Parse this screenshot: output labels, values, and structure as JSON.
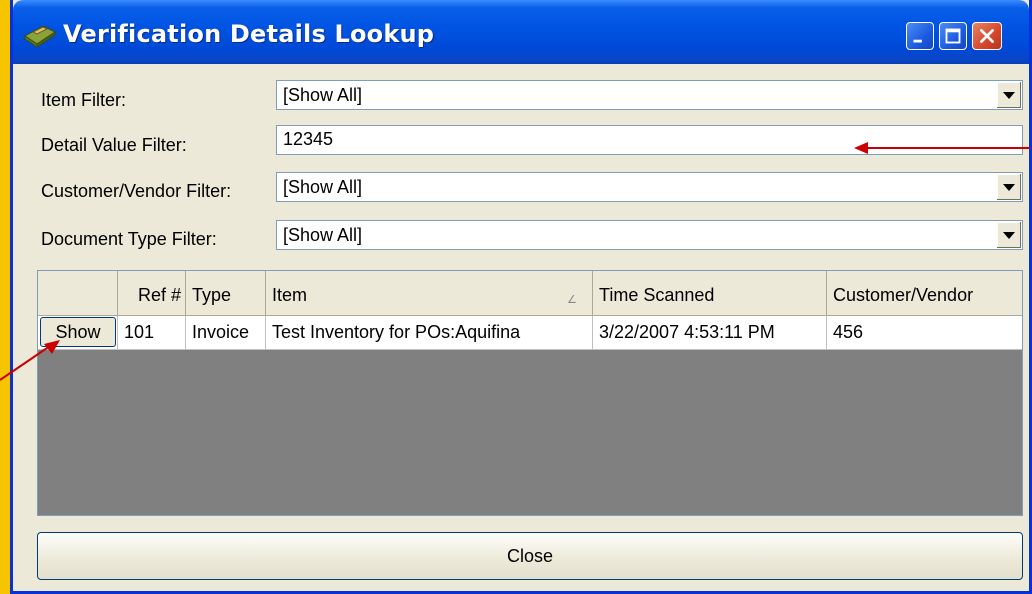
{
  "window": {
    "title": "Verification Details Lookup"
  },
  "filters": {
    "item": {
      "label": "Item Filter:",
      "value": "[Show All]"
    },
    "detail_value": {
      "label": "Detail Value Filter:",
      "value": "12345"
    },
    "customer_vendor": {
      "label": "Customer/Vendor Filter:",
      "value": "[Show All]"
    },
    "document_type": {
      "label": "Document Type Filter:",
      "value": "[Show All]"
    }
  },
  "grid": {
    "columns": [
      "",
      "Ref #",
      "Type",
      "Item",
      "Time Scanned",
      "Customer/Vendor"
    ],
    "rows": [
      {
        "button": "Show",
        "ref": "101",
        "type": "Invoice",
        "item": "Test Inventory for POs:Aquifina",
        "time_scanned": "3/22/2007 4:53:11 PM",
        "customer_vendor": "456"
      }
    ]
  },
  "close_label": "Close",
  "colors": {
    "background": "#f7c400",
    "titlebar": "#0054e3",
    "annotation_arrow": "#cc0000"
  }
}
